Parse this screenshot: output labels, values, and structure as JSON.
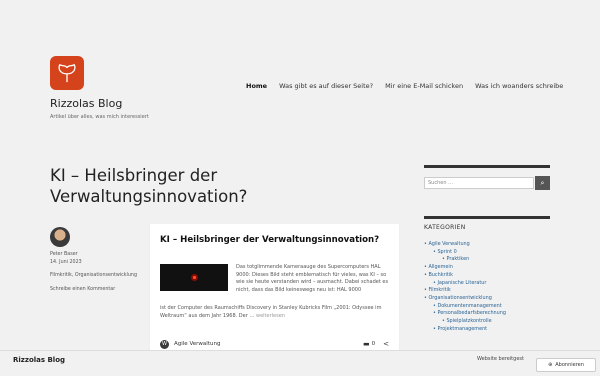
{
  "site": {
    "title": "Rizzolas Blog",
    "description": "Artikel über alles, was mich interessiert",
    "logo_icon": "ginkgo-leaf-icon"
  },
  "nav": {
    "items": [
      {
        "label": "Home",
        "active": true
      },
      {
        "label": "Was gibt es auf dieser Seite?"
      },
      {
        "label": "Mir eine E-Mail schicken"
      },
      {
        "label": "Was ich woanders schreibe"
      }
    ]
  },
  "page": {
    "title": "KI – Heilsbringer der Verwaltungsinnovation?"
  },
  "author": {
    "name": "Peter Baser",
    "date": "14. Juni 2023",
    "tags": "Filmkritik, Organisationsentwicklung",
    "comment_link": "Schreibe einen Kommentar"
  },
  "card": {
    "title": "KI – Heilsbringer der Verwaltungsinnovation?",
    "excerpt_side": "Das totglimmende Kameraauge des Supercomputers HAL 9000: Dieses Bild steht emblematisch für vieles, was KI – so wie sie heute verstanden wird – ausmacht. Dabei schadet es nicht, dass das Bild keineswegs neu ist: HAL 9000",
    "excerpt_full": "ist der Computer des Raumschiffs Discovery in Stanley Kubricks Film „2001: Odyssee im Weltraum“ aus dem Jahr 1968. Der …",
    "more": "weiterlesen",
    "category": "Agile Verwaltung",
    "comments": "0"
  },
  "sidebar": {
    "search_placeholder": "Suchen …",
    "categories_heading": "KATEGORIEN",
    "categories": [
      {
        "label": "Agile Verwaltung",
        "level": 1
      },
      {
        "label": "Sprint 0",
        "level": 2
      },
      {
        "label": "Praktiken",
        "level": 3
      },
      {
        "label": "Allgemein",
        "level": 1
      },
      {
        "label": "Buchkritik",
        "level": 1
      },
      {
        "label": "Japanische Literatur",
        "level": 2
      },
      {
        "label": "Filmkritik",
        "level": 1
      },
      {
        "label": "Organisationsentwicklung",
        "level": 1
      },
      {
        "label": "Dokumentenmanagement",
        "level": 2
      },
      {
        "label": "Personalbedarfsberechnung",
        "level": 2
      },
      {
        "label": "Spielplatzkontrolle",
        "level": 3
      },
      {
        "label": "Projektmanagement",
        "level": 2
      }
    ]
  },
  "footer_bar": {
    "title": "Rizzolas Blog",
    "note": "Website bereitgest",
    "subscribe": "Abonnieren"
  },
  "colors": {
    "background": "#f1f1f1",
    "accent": "#d4431b",
    "link": "#2a6496"
  }
}
